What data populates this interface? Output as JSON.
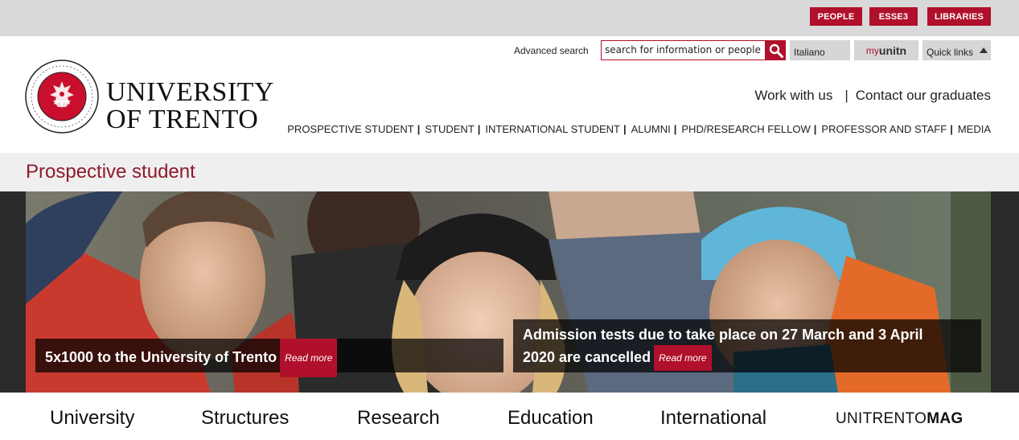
{
  "topbar": {
    "buttons": [
      "PEOPLE",
      "ESSE3",
      "LIBRARIES"
    ]
  },
  "brand": {
    "line1": "UNIVERSITY",
    "line2": "OF TRENTO"
  },
  "search": {
    "advanced_label": "Advanced search",
    "placeholder": "search for information or people",
    "value": "search for information or people"
  },
  "language": {
    "selected": "Italiano"
  },
  "myunitn": {
    "prefix": "my",
    "suffix": "unitn"
  },
  "quicklinks": {
    "label": "Quick links"
  },
  "headerlinks": [
    "Work with us",
    "Contact our graduates"
  ],
  "headerlinks_sep": "|",
  "mainnav": [
    "PROSPECTIVE STUDENT",
    "STUDENT",
    "INTERNATIONAL STUDENT",
    "ALUMNI",
    "PHD/RESEARCH FELLOW",
    "PROFESSOR AND STAFF",
    "MEDIA"
  ],
  "section": {
    "title": "Prospective student"
  },
  "hero": {
    "caption_left": "5x1000 to the University of Trento",
    "caption_right_line1": "Admission tests due to take place on 27 March and 3 April",
    "caption_right_line2": "2020 are cancelled",
    "read_more": "Read more"
  },
  "bottomnav": {
    "items": [
      "University",
      "Structures",
      "Research",
      "Education",
      "International"
    ],
    "mag_light": "UNITRENTO",
    "mag_bold": "MAG"
  },
  "colors": {
    "brand_red": "#b0102b",
    "section_title": "#8e1a2c"
  }
}
